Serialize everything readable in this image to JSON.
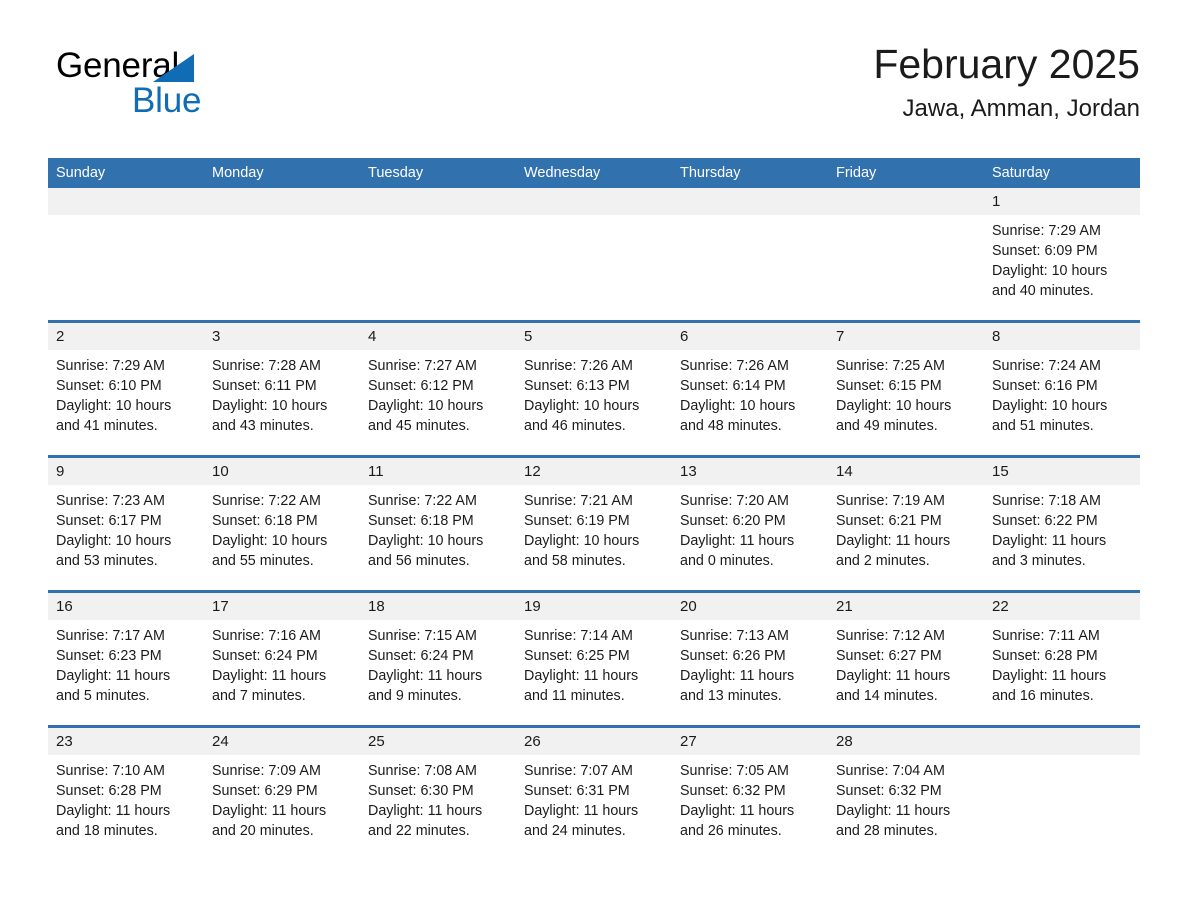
{
  "brand": {
    "name_part1": "General",
    "name_part2": "Blue",
    "triangle_color": "#0f6cb5"
  },
  "header": {
    "title": "February 2025",
    "subtitle": "Jawa, Amman, Jordan",
    "accent_color": "#3071ae",
    "daynum_band_color": "#f1f1f1"
  },
  "weekdays": [
    "Sunday",
    "Monday",
    "Tuesday",
    "Wednesday",
    "Thursday",
    "Friday",
    "Saturday"
  ],
  "weeks": [
    [
      {
        "day": "",
        "sunrise": "",
        "sunset": "",
        "daylight": "",
        "daylight2": ""
      },
      {
        "day": "",
        "sunrise": "",
        "sunset": "",
        "daylight": "",
        "daylight2": ""
      },
      {
        "day": "",
        "sunrise": "",
        "sunset": "",
        "daylight": "",
        "daylight2": ""
      },
      {
        "day": "",
        "sunrise": "",
        "sunset": "",
        "daylight": "",
        "daylight2": ""
      },
      {
        "day": "",
        "sunrise": "",
        "sunset": "",
        "daylight": "",
        "daylight2": ""
      },
      {
        "day": "",
        "sunrise": "",
        "sunset": "",
        "daylight": "",
        "daylight2": ""
      },
      {
        "day": "1",
        "sunrise": "Sunrise: 7:29 AM",
        "sunset": "Sunset: 6:09 PM",
        "daylight": "Daylight: 10 hours",
        "daylight2": "and 40 minutes."
      }
    ],
    [
      {
        "day": "2",
        "sunrise": "Sunrise: 7:29 AM",
        "sunset": "Sunset: 6:10 PM",
        "daylight": "Daylight: 10 hours",
        "daylight2": "and 41 minutes."
      },
      {
        "day": "3",
        "sunrise": "Sunrise: 7:28 AM",
        "sunset": "Sunset: 6:11 PM",
        "daylight": "Daylight: 10 hours",
        "daylight2": "and 43 minutes."
      },
      {
        "day": "4",
        "sunrise": "Sunrise: 7:27 AM",
        "sunset": "Sunset: 6:12 PM",
        "daylight": "Daylight: 10 hours",
        "daylight2": "and 45 minutes."
      },
      {
        "day": "5",
        "sunrise": "Sunrise: 7:26 AM",
        "sunset": "Sunset: 6:13 PM",
        "daylight": "Daylight: 10 hours",
        "daylight2": "and 46 minutes."
      },
      {
        "day": "6",
        "sunrise": "Sunrise: 7:26 AM",
        "sunset": "Sunset: 6:14 PM",
        "daylight": "Daylight: 10 hours",
        "daylight2": "and 48 minutes."
      },
      {
        "day": "7",
        "sunrise": "Sunrise: 7:25 AM",
        "sunset": "Sunset: 6:15 PM",
        "daylight": "Daylight: 10 hours",
        "daylight2": "and 49 minutes."
      },
      {
        "day": "8",
        "sunrise": "Sunrise: 7:24 AM",
        "sunset": "Sunset: 6:16 PM",
        "daylight": "Daylight: 10 hours",
        "daylight2": "and 51 minutes."
      }
    ],
    [
      {
        "day": "9",
        "sunrise": "Sunrise: 7:23 AM",
        "sunset": "Sunset: 6:17 PM",
        "daylight": "Daylight: 10 hours",
        "daylight2": "and 53 minutes."
      },
      {
        "day": "10",
        "sunrise": "Sunrise: 7:22 AM",
        "sunset": "Sunset: 6:18 PM",
        "daylight": "Daylight: 10 hours",
        "daylight2": "and 55 minutes."
      },
      {
        "day": "11",
        "sunrise": "Sunrise: 7:22 AM",
        "sunset": "Sunset: 6:18 PM",
        "daylight": "Daylight: 10 hours",
        "daylight2": "and 56 minutes."
      },
      {
        "day": "12",
        "sunrise": "Sunrise: 7:21 AM",
        "sunset": "Sunset: 6:19 PM",
        "daylight": "Daylight: 10 hours",
        "daylight2": "and 58 minutes."
      },
      {
        "day": "13",
        "sunrise": "Sunrise: 7:20 AM",
        "sunset": "Sunset: 6:20 PM",
        "daylight": "Daylight: 11 hours",
        "daylight2": "and 0 minutes."
      },
      {
        "day": "14",
        "sunrise": "Sunrise: 7:19 AM",
        "sunset": "Sunset: 6:21 PM",
        "daylight": "Daylight: 11 hours",
        "daylight2": "and 2 minutes."
      },
      {
        "day": "15",
        "sunrise": "Sunrise: 7:18 AM",
        "sunset": "Sunset: 6:22 PM",
        "daylight": "Daylight: 11 hours",
        "daylight2": "and 3 minutes."
      }
    ],
    [
      {
        "day": "16",
        "sunrise": "Sunrise: 7:17 AM",
        "sunset": "Sunset: 6:23 PM",
        "daylight": "Daylight: 11 hours",
        "daylight2": "and 5 minutes."
      },
      {
        "day": "17",
        "sunrise": "Sunrise: 7:16 AM",
        "sunset": "Sunset: 6:24 PM",
        "daylight": "Daylight: 11 hours",
        "daylight2": "and 7 minutes."
      },
      {
        "day": "18",
        "sunrise": "Sunrise: 7:15 AM",
        "sunset": "Sunset: 6:24 PM",
        "daylight": "Daylight: 11 hours",
        "daylight2": "and 9 minutes."
      },
      {
        "day": "19",
        "sunrise": "Sunrise: 7:14 AM",
        "sunset": "Sunset: 6:25 PM",
        "daylight": "Daylight: 11 hours",
        "daylight2": "and 11 minutes."
      },
      {
        "day": "20",
        "sunrise": "Sunrise: 7:13 AM",
        "sunset": "Sunset: 6:26 PM",
        "daylight": "Daylight: 11 hours",
        "daylight2": "and 13 minutes."
      },
      {
        "day": "21",
        "sunrise": "Sunrise: 7:12 AM",
        "sunset": "Sunset: 6:27 PM",
        "daylight": "Daylight: 11 hours",
        "daylight2": "and 14 minutes."
      },
      {
        "day": "22",
        "sunrise": "Sunrise: 7:11 AM",
        "sunset": "Sunset: 6:28 PM",
        "daylight": "Daylight: 11 hours",
        "daylight2": "and 16 minutes."
      }
    ],
    [
      {
        "day": "23",
        "sunrise": "Sunrise: 7:10 AM",
        "sunset": "Sunset: 6:28 PM",
        "daylight": "Daylight: 11 hours",
        "daylight2": "and 18 minutes."
      },
      {
        "day": "24",
        "sunrise": "Sunrise: 7:09 AM",
        "sunset": "Sunset: 6:29 PM",
        "daylight": "Daylight: 11 hours",
        "daylight2": "and 20 minutes."
      },
      {
        "day": "25",
        "sunrise": "Sunrise: 7:08 AM",
        "sunset": "Sunset: 6:30 PM",
        "daylight": "Daylight: 11 hours",
        "daylight2": "and 22 minutes."
      },
      {
        "day": "26",
        "sunrise": "Sunrise: 7:07 AM",
        "sunset": "Sunset: 6:31 PM",
        "daylight": "Daylight: 11 hours",
        "daylight2": "and 24 minutes."
      },
      {
        "day": "27",
        "sunrise": "Sunrise: 7:05 AM",
        "sunset": "Sunset: 6:32 PM",
        "daylight": "Daylight: 11 hours",
        "daylight2": "and 26 minutes."
      },
      {
        "day": "28",
        "sunrise": "Sunrise: 7:04 AM",
        "sunset": "Sunset: 6:32 PM",
        "daylight": "Daylight: 11 hours",
        "daylight2": "and 28 minutes."
      },
      {
        "day": "",
        "sunrise": "",
        "sunset": "",
        "daylight": "",
        "daylight2": ""
      }
    ]
  ]
}
